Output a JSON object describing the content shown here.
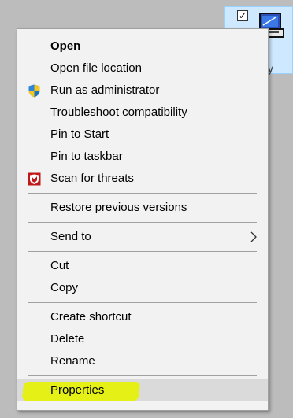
{
  "desktop_icon": {
    "checkbox_mark": "✓",
    "caption": "ty"
  },
  "menu": {
    "items": [
      {
        "label": "Open"
      },
      {
        "label": "Open file location"
      },
      {
        "label": "Run as administrator",
        "icon": "uac-shield-icon"
      },
      {
        "label": "Troubleshoot compatibility"
      },
      {
        "label": "Pin to Start"
      },
      {
        "label": "Pin to taskbar"
      },
      {
        "label": "Scan for threats",
        "icon": "mcafee-shield-icon"
      },
      {
        "label": "Restore previous versions"
      },
      {
        "label": "Send to",
        "icon": "chevron-right-icon"
      },
      {
        "label": "Cut"
      },
      {
        "label": "Copy"
      },
      {
        "label": "Create shortcut"
      },
      {
        "label": "Delete"
      },
      {
        "label": "Rename"
      },
      {
        "label": "Properties"
      }
    ]
  },
  "colors": {
    "menu_bg": "#f2f2f2",
    "highlight_marker": "#e6f200",
    "uac_blue": "#1e73be",
    "uac_yellow": "#f3c623",
    "mcafee_red": "#c01818"
  }
}
